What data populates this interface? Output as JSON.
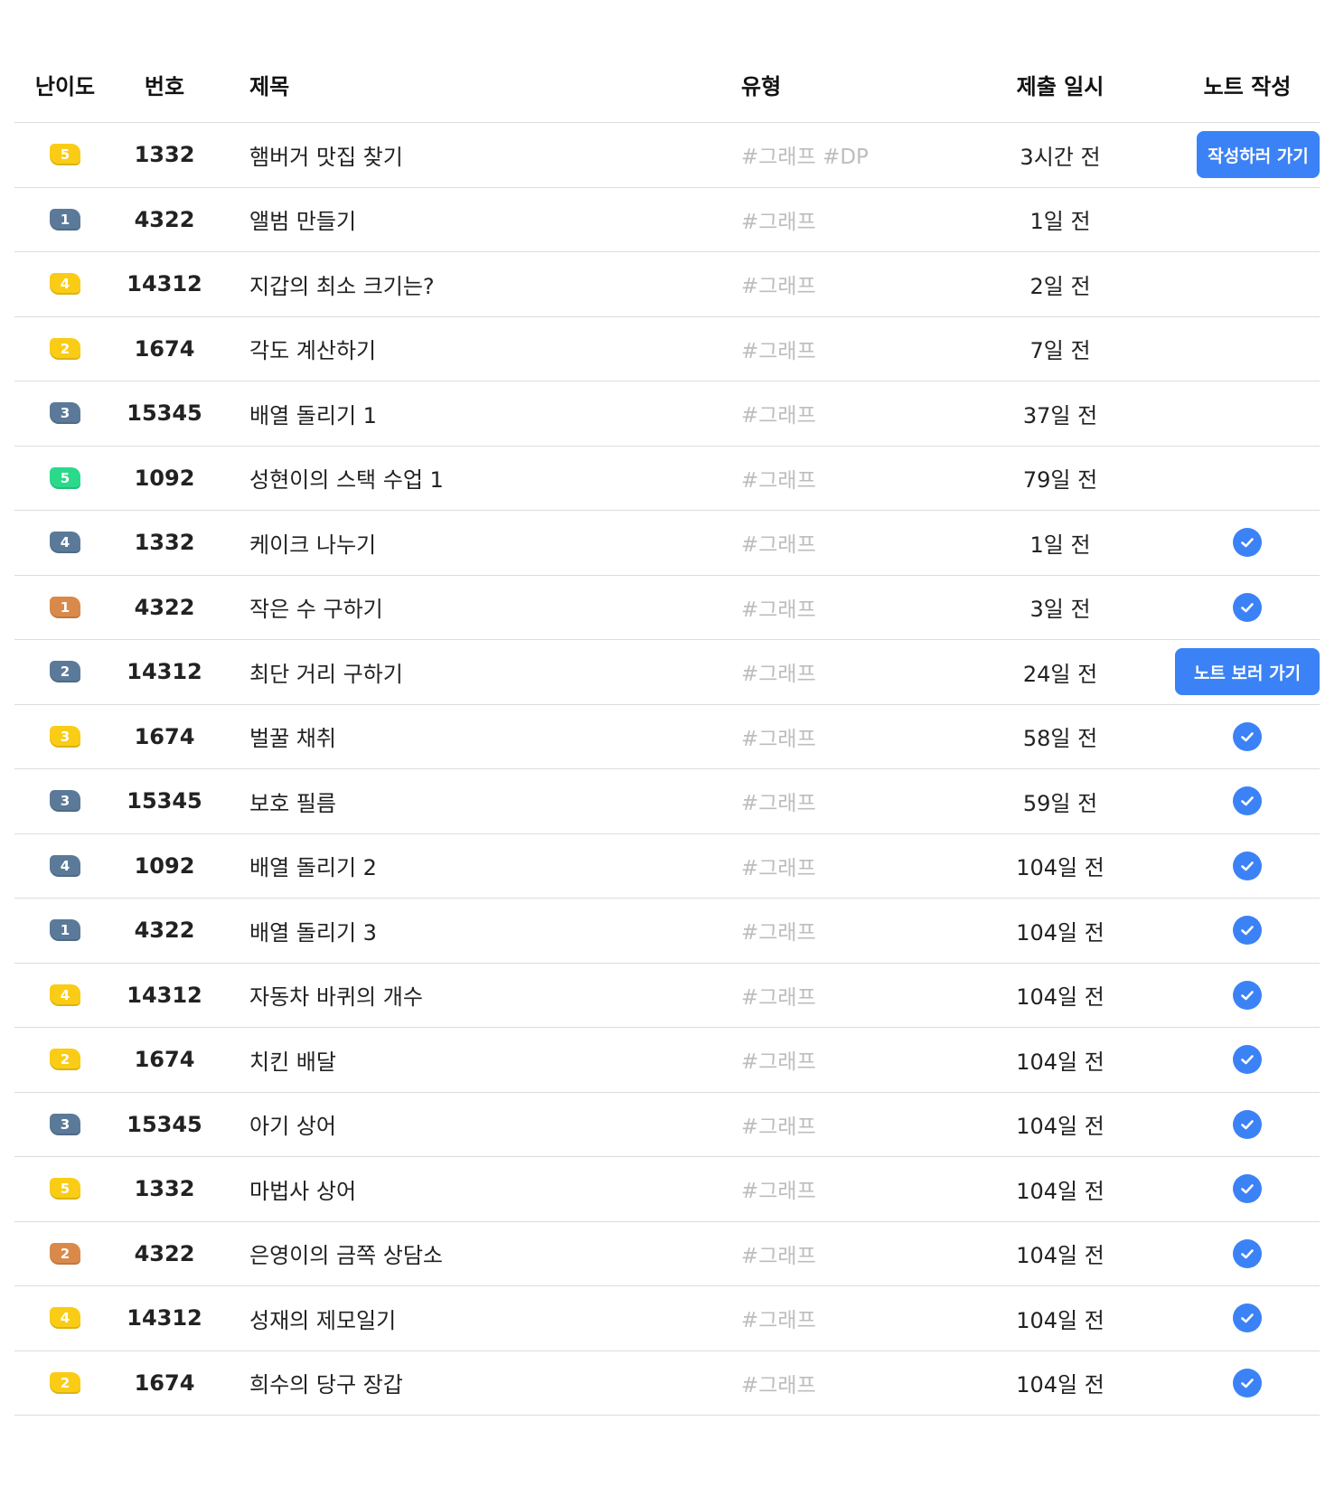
{
  "header": {
    "level": "난이도",
    "number": "번호",
    "title": "제목",
    "type": "유형",
    "date": "제출 일시",
    "note": "노트 작성"
  },
  "rows": [
    {
      "level": "5",
      "level_color": "#FACC15",
      "number": "1332",
      "title": "햄버거 맛집 찾기",
      "tags": "#그래프 #DP",
      "date": "3시간 전",
      "note": "write",
      "note_label": "작성하러 가기"
    },
    {
      "level": "1",
      "level_color": "#5B7A99",
      "number": "4322",
      "title": "앨범 만들기",
      "tags": "#그래프",
      "date": "1일 전",
      "note": "none"
    },
    {
      "level": "4",
      "level_color": "#FACC15",
      "number": "14312",
      "title": "지갑의 최소 크기는?",
      "tags": "#그래프",
      "date": "2일 전",
      "note": "none"
    },
    {
      "level": "2",
      "level_color": "#FACC15",
      "number": "1674",
      "title": "각도 계산하기",
      "tags": "#그래프",
      "date": "7일 전",
      "note": "none"
    },
    {
      "level": "3",
      "level_color": "#5B7A99",
      "number": "15345",
      "title": "배열 돌리기 1",
      "tags": "#그래프",
      "date": "37일 전",
      "note": "none"
    },
    {
      "level": "5",
      "level_color": "#2BD98B",
      "number": "1092",
      "title": "성현이의 스택 수업 1",
      "tags": "#그래프",
      "date": "79일 전",
      "note": "none"
    },
    {
      "level": "4",
      "level_color": "#5B7A99",
      "number": "1332",
      "title": "케이크 나누기",
      "tags": "#그래프",
      "date": "1일 전",
      "note": "done"
    },
    {
      "level": "1",
      "level_color": "#D98A4B",
      "number": "4322",
      "title": "작은 수 구하기",
      "tags": "#그래프",
      "date": "3일 전",
      "note": "done"
    },
    {
      "level": "2",
      "level_color": "#5B7A99",
      "number": "14312",
      "title": "최단 거리 구하기",
      "tags": "#그래프",
      "date": "24일 전",
      "note": "view",
      "note_label": "노트 보러 가기"
    },
    {
      "level": "3",
      "level_color": "#FACC15",
      "number": "1674",
      "title": "벌꿀 채취",
      "tags": "#그래프",
      "date": "58일 전",
      "note": "done"
    },
    {
      "level": "3",
      "level_color": "#5B7A99",
      "number": "15345",
      "title": "보호 필름",
      "tags": "#그래프",
      "date": "59일 전",
      "note": "done"
    },
    {
      "level": "4",
      "level_color": "#5B7A99",
      "number": "1092",
      "title": "배열 돌리기 2",
      "tags": "#그래프",
      "date": "104일 전",
      "note": "done"
    },
    {
      "level": "1",
      "level_color": "#5B7A99",
      "number": "4322",
      "title": "배열 돌리기 3",
      "tags": "#그래프",
      "date": "104일 전",
      "note": "done"
    },
    {
      "level": "4",
      "level_color": "#FACC15",
      "number": "14312",
      "title": "자동차 바퀴의 개수",
      "tags": "#그래프",
      "date": "104일 전",
      "note": "done"
    },
    {
      "level": "2",
      "level_color": "#FACC15",
      "number": "1674",
      "title": "치킨 배달",
      "tags": "#그래프",
      "date": "104일 전",
      "note": "done"
    },
    {
      "level": "3",
      "level_color": "#5B7A99",
      "number": "15345",
      "title": "아기 상어",
      "tags": "#그래프",
      "date": "104일 전",
      "note": "done"
    },
    {
      "level": "5",
      "level_color": "#FACC15",
      "number": "1332",
      "title": "마법사 상어",
      "tags": "#그래프",
      "date": "104일 전",
      "note": "done"
    },
    {
      "level": "2",
      "level_color": "#D98A4B",
      "number": "4322",
      "title": "은영이의 금쪽 상담소",
      "tags": "#그래프",
      "date": "104일 전",
      "note": "done"
    },
    {
      "level": "4",
      "level_color": "#FACC15",
      "number": "14312",
      "title": "성재의 제모일기",
      "tags": "#그래프",
      "date": "104일 전",
      "note": "done"
    },
    {
      "level": "2",
      "level_color": "#FACC15",
      "number": "1674",
      "title": "희수의 당구 장갑",
      "tags": "#그래프",
      "date": "104일 전",
      "note": "done"
    }
  ],
  "colors": {
    "accent": "#3B82F6",
    "divider": "#DCDCDC",
    "tag_text": "#BDBDBD"
  }
}
